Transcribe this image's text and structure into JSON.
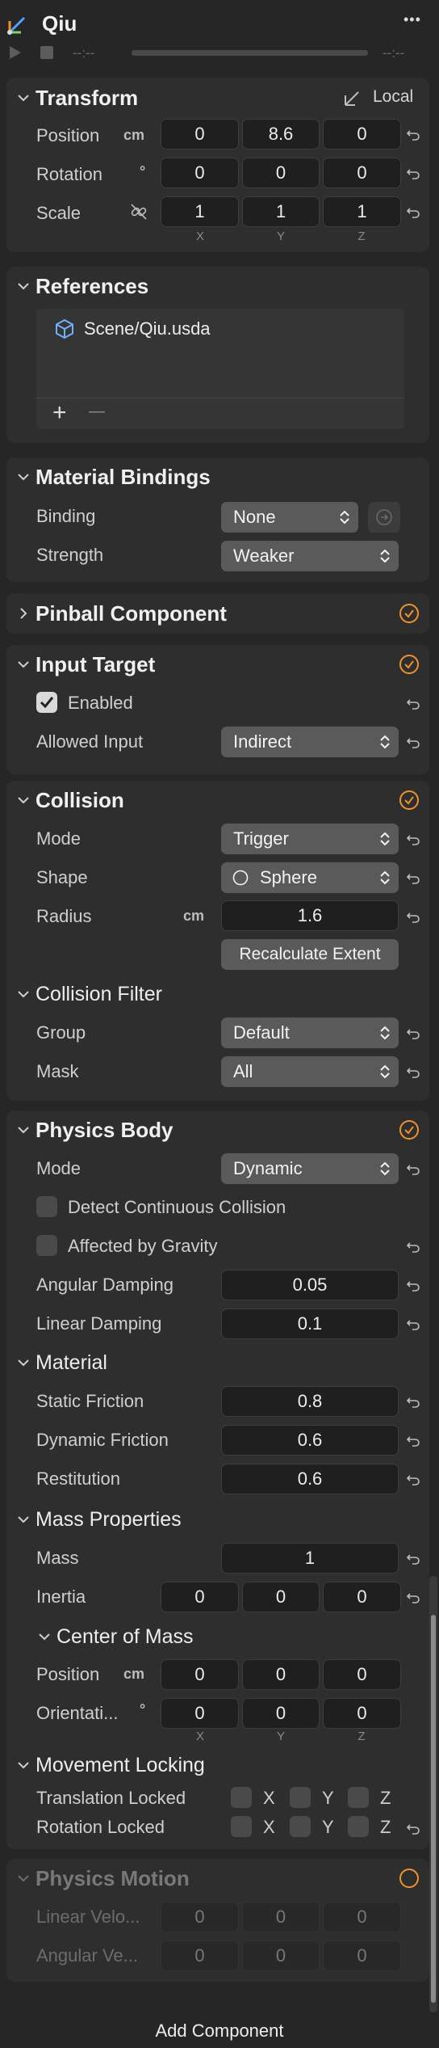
{
  "header": {
    "title": "Qiu",
    "more": "•••"
  },
  "playback": {
    "time_start": "--:--",
    "time_end": "--:--"
  },
  "transform": {
    "title": "Transform",
    "space": "Local",
    "position": {
      "label": "Position",
      "unit": "cm",
      "x": "0",
      "y": "8.6",
      "z": "0"
    },
    "rotation": {
      "label": "Rotation",
      "unit": "°",
      "x": "0",
      "y": "0",
      "z": "0"
    },
    "scale": {
      "label": "Scale",
      "x": "1",
      "y": "1",
      "z": "1"
    },
    "axes": {
      "x": "X",
      "y": "Y",
      "z": "Z"
    }
  },
  "references": {
    "title": "References",
    "items": [
      "Scene/Qiu.usda"
    ],
    "add": "+",
    "remove": "—"
  },
  "material_bindings": {
    "title": "Material Bindings",
    "binding": {
      "label": "Binding",
      "value": "None"
    },
    "strength": {
      "label": "Strength",
      "value": "Weaker"
    }
  },
  "pinball": {
    "title": "Pinball Component"
  },
  "input_target": {
    "title": "Input Target",
    "enabled": {
      "label": "Enabled",
      "checked": true
    },
    "allowed_input": {
      "label": "Allowed Input",
      "value": "Indirect"
    }
  },
  "collision": {
    "title": "Collision",
    "mode": {
      "label": "Mode",
      "value": "Trigger"
    },
    "shape": {
      "label": "Shape",
      "value": "Sphere"
    },
    "radius": {
      "label": "Radius",
      "unit": "cm",
      "value": "1.6"
    },
    "recalculate": "Recalculate Extent",
    "filter": {
      "title": "Collision Filter",
      "group": {
        "label": "Group",
        "value": "Default"
      },
      "mask": {
        "label": "Mask",
        "value": "All"
      }
    }
  },
  "physics_body": {
    "title": "Physics Body",
    "mode": {
      "label": "Mode",
      "value": "Dynamic"
    },
    "continuous": {
      "label": "Detect Continuous Collision",
      "checked": false
    },
    "gravity": {
      "label": "Affected by Gravity",
      "checked": false
    },
    "angular_damping": {
      "label": "Angular Damping",
      "value": "0.05"
    },
    "linear_damping": {
      "label": "Linear Damping",
      "value": "0.1"
    },
    "material": {
      "title": "Material",
      "static_friction": {
        "label": "Static Friction",
        "value": "0.8"
      },
      "dynamic_friction": {
        "label": "Dynamic Friction",
        "value": "0.6"
      },
      "restitution": {
        "label": "Restitution",
        "value": "0.6"
      }
    },
    "mass_properties": {
      "title": "Mass Properties",
      "mass": {
        "label": "Mass",
        "value": "1"
      },
      "inertia": {
        "label": "Inertia",
        "x": "0",
        "y": "0",
        "z": "0"
      },
      "center_of_mass": {
        "title": "Center of Mass",
        "position": {
          "label": "Position",
          "unit": "cm",
          "x": "0",
          "y": "0",
          "z": "0"
        },
        "orientation": {
          "label": "Orientati...",
          "unit": "°",
          "x": "0",
          "y": "0",
          "z": "0"
        }
      }
    },
    "movement_locking": {
      "title": "Movement Locking",
      "translation": {
        "label": "Translation Locked",
        "x": "X",
        "y": "Y",
        "z": "Z"
      },
      "rotation": {
        "label": "Rotation Locked",
        "x": "X",
        "y": "Y",
        "z": "Z"
      }
    }
  },
  "physics_motion": {
    "title": "Physics Motion",
    "linear_velocity": {
      "label": "Linear Velo...",
      "x": "0",
      "y": "0",
      "z": "0"
    },
    "angular_velocity": {
      "label": "Angular Ve...",
      "x": "0",
      "y": "0",
      "z": "0"
    }
  },
  "add_component": "Add Component",
  "colors": {
    "accent_orange": "#f0922b",
    "panel": "#2e2e2e",
    "background": "#262626",
    "dropdown": "#5a5a5a",
    "field": "#1f1f1f"
  }
}
